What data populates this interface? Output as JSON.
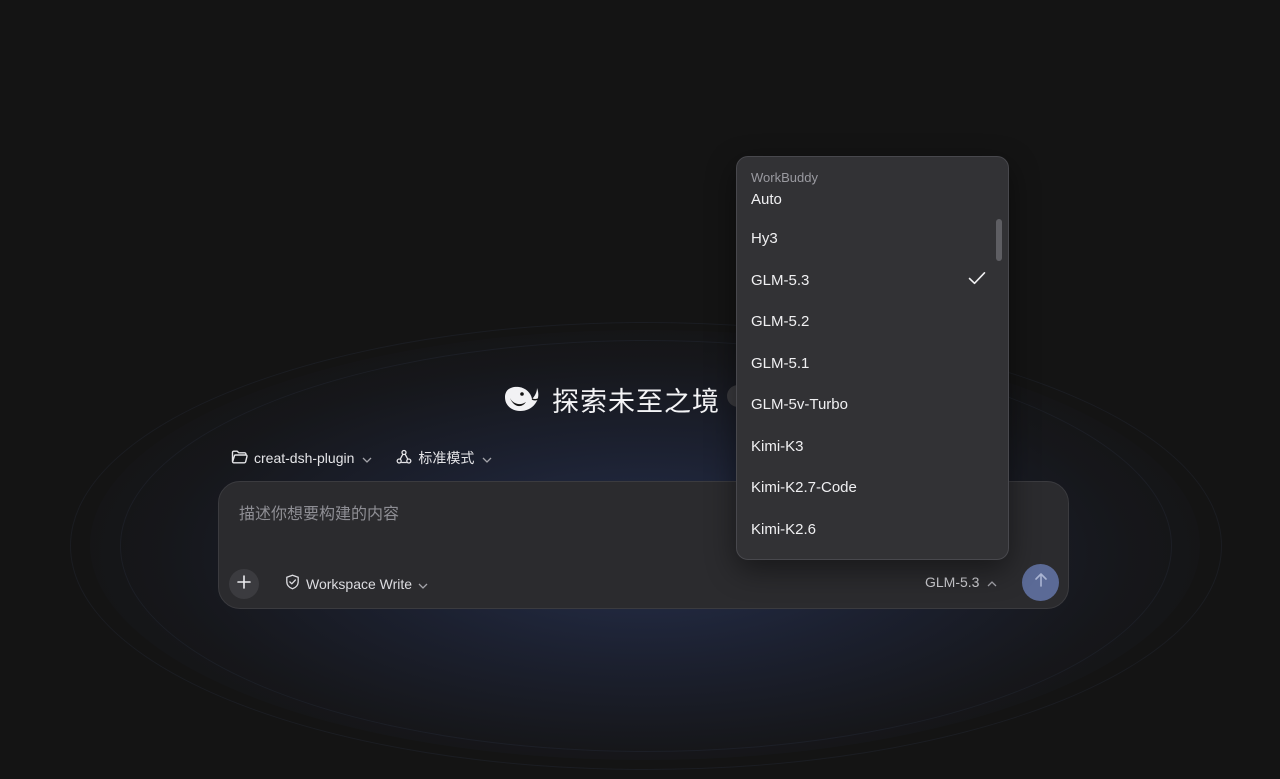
{
  "hero": {
    "title": "探索未至之境",
    "logo_icon": "whale-logo-icon"
  },
  "selectors": {
    "project": {
      "label": "creat-dsh-plugin",
      "icon": "folder-icon"
    },
    "mode": {
      "label": "标准模式",
      "icon": "recycle-icon"
    }
  },
  "composer": {
    "placeholder": "描述你想要构建的内容",
    "value": "",
    "permission_label": "Workspace Write",
    "model_label": "GLM-5.3",
    "send_icon": "arrow-up-icon",
    "add_icon": "plus-icon"
  },
  "model_menu": {
    "group_label": "WorkBuddy",
    "selected": "GLM-5.3",
    "items": [
      {
        "label": "Auto"
      },
      {
        "label": "Hy3"
      },
      {
        "label": "GLM-5.3"
      },
      {
        "label": "GLM-5.2"
      },
      {
        "label": "GLM-5.1"
      },
      {
        "label": "GLM-5v-Turbo"
      },
      {
        "label": "Kimi-K3"
      },
      {
        "label": "Kimi-K2.7-Code"
      },
      {
        "label": "Kimi-K2.6"
      }
    ]
  },
  "colors": {
    "background": "#141414",
    "composer_bg": "#2b2b2e",
    "menu_bg": "#323235",
    "send_button": "#5b6a96"
  }
}
